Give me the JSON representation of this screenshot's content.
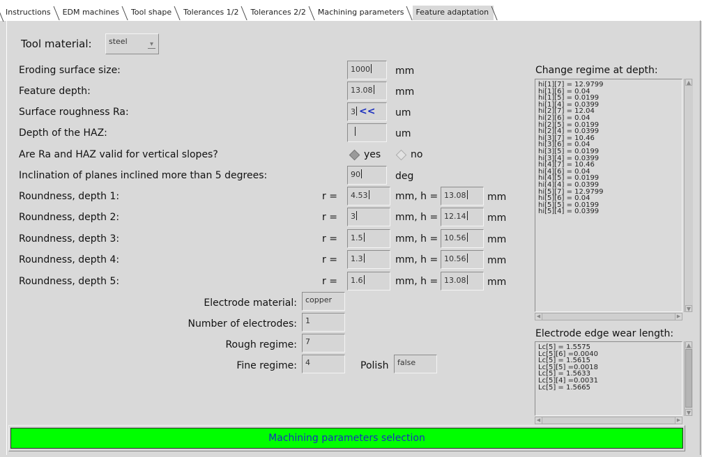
{
  "tabs": [
    "Instructions",
    "EDM machines",
    "Tool shape",
    "Tolerances 1/2",
    "Tolerances 2/2",
    "Machining parameters",
    "Feature adaptation"
  ],
  "active_tab_index": 6,
  "tool_material": {
    "label": "Tool material:",
    "value": "steel"
  },
  "rows": {
    "eroding": {
      "label": "Eroding surface size:",
      "value": "1000",
      "unit": "mm"
    },
    "depth": {
      "label": "Feature depth:",
      "value": "13.08",
      "unit": "mm"
    },
    "roughness": {
      "label": "Surface roughness Ra:",
      "value": "3",
      "marker": "<<",
      "unit": "um"
    },
    "haz": {
      "label": "Depth of the HAZ:",
      "value": "",
      "unit": "um"
    },
    "valid": {
      "label": "Are Ra and HAZ valid for vertical slopes?",
      "yes": "yes",
      "no": "no",
      "selected": "yes"
    },
    "inclination": {
      "label": "Inclination of planes inclined more than 5 degrees:",
      "value": "90",
      "unit": "deg"
    }
  },
  "roundness": [
    {
      "label": "Roundness, depth 1:",
      "r_label": "r =",
      "r": "4.53",
      "h_label": "mm, h =",
      "h": "13.08",
      "unit": "mm"
    },
    {
      "label": "Roundness, depth 2:",
      "r_label": "r =",
      "r": "3",
      "h_label": "mm, h =",
      "h": "12.14",
      "unit": "mm"
    },
    {
      "label": "Roundness, depth 3:",
      "r_label": "r =",
      "r": "1.5",
      "h_label": "mm, h =",
      "h": "10.56",
      "unit": "mm"
    },
    {
      "label": "Roundness, depth 4:",
      "r_label": "r =",
      "r": "1.3",
      "h_label": "mm, h =",
      "h": "10.56",
      "unit": "mm"
    },
    {
      "label": "Roundness, depth 5:",
      "r_label": "r =",
      "r": "1.6",
      "h_label": "mm, h =",
      "h": "13.08",
      "unit": "mm"
    }
  ],
  "electrode": {
    "material": {
      "label": "Electrode material:",
      "value": "copper"
    },
    "count": {
      "label": "Number of electrodes:",
      "value": "1"
    },
    "rough": {
      "label": "Rough regime:",
      "value": "7"
    },
    "fine": {
      "label": "Fine regime:",
      "value": "4"
    },
    "polish": {
      "label": "Polish",
      "value": "false"
    }
  },
  "regime_panel": {
    "title": "Change regime at depth:",
    "lines": [
      "hi[1][7] = 12.9799",
      "hi[1][6] = 0.04",
      "hi[1][5] = 0.0199",
      "hi[1][4] = 0.0399",
      "hi[2][7] = 12.04",
      "hi[2][6] = 0.04",
      "hi[2][5] = 0.0199",
      "hi[2][4] = 0.0399",
      "hi[3][7] = 10.46",
      "hi[3][6] = 0.04",
      "hi[3][5] = 0.0199",
      "hi[3][4] = 0.0399",
      "hi[4][7] = 10.46",
      "hi[4][6] = 0.04",
      "hi[4][5] = 0.0199",
      "hi[4][4] = 0.0399",
      "hi[5][7] = 12.9799",
      "hi[5][6] = 0.04",
      "hi[5][5] = 0.0199",
      "hi[5][4] = 0.0399"
    ]
  },
  "wear_panel": {
    "title": "Electrode edge wear length:",
    "lines": [
      "Lc[5] = 1.5575",
      "Lc[5][6] =0.0040",
      "Lc[5] = 1.5615",
      "Lc[5][5] =0.0018",
      "Lc[5] = 1.5633",
      "Lc[5][4] =0.0031",
      "Lc[5] = 1.5665"
    ]
  },
  "status": {
    "text": "Machining parameters selection",
    "color": "#00ff00",
    "text_color": "#1a2ebf"
  },
  "colors": {
    "background": "#d9d9d9",
    "marker": "#1a2ebf"
  }
}
